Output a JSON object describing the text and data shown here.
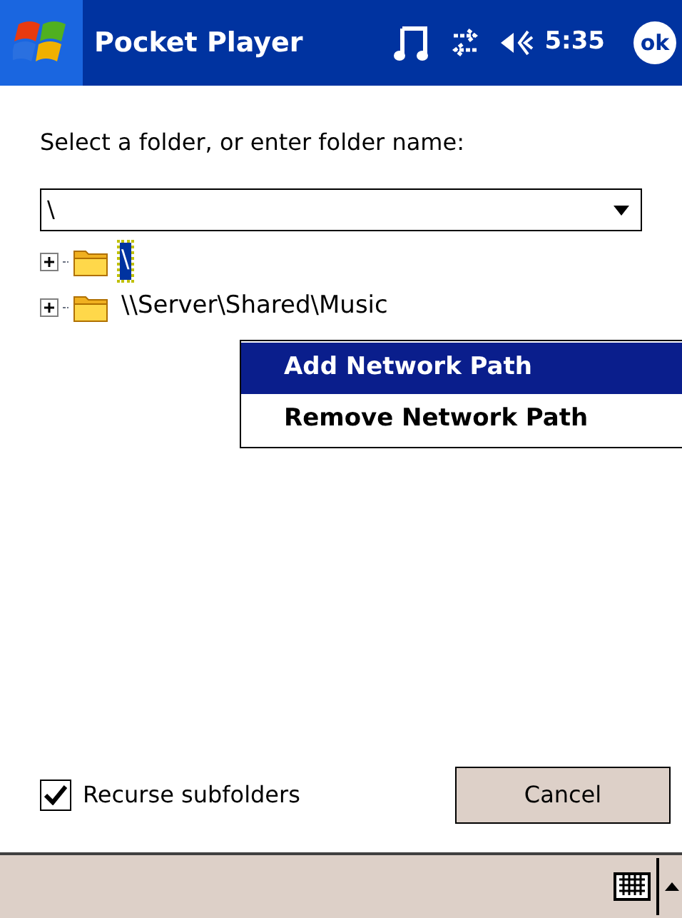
{
  "title_bar": {
    "title": "Pocket Player",
    "time": "5:35",
    "ok": "ok"
  },
  "prompt": "Select a folder, or enter folder name:",
  "folder_field": {
    "value": "\\"
  },
  "tree": [
    {
      "label": "\\",
      "selected": true,
      "expanded": false
    },
    {
      "label": "\\\\Server\\Shared\\Music",
      "selected": false,
      "expanded": false
    }
  ],
  "context_menu": [
    {
      "label": "Add Network Path",
      "selected": true
    },
    {
      "label": "Remove Network Path",
      "selected": false
    }
  ],
  "recurse_subfolders": {
    "label": "Recurse subfolders",
    "checked": true
  },
  "cancel_button": "Cancel"
}
